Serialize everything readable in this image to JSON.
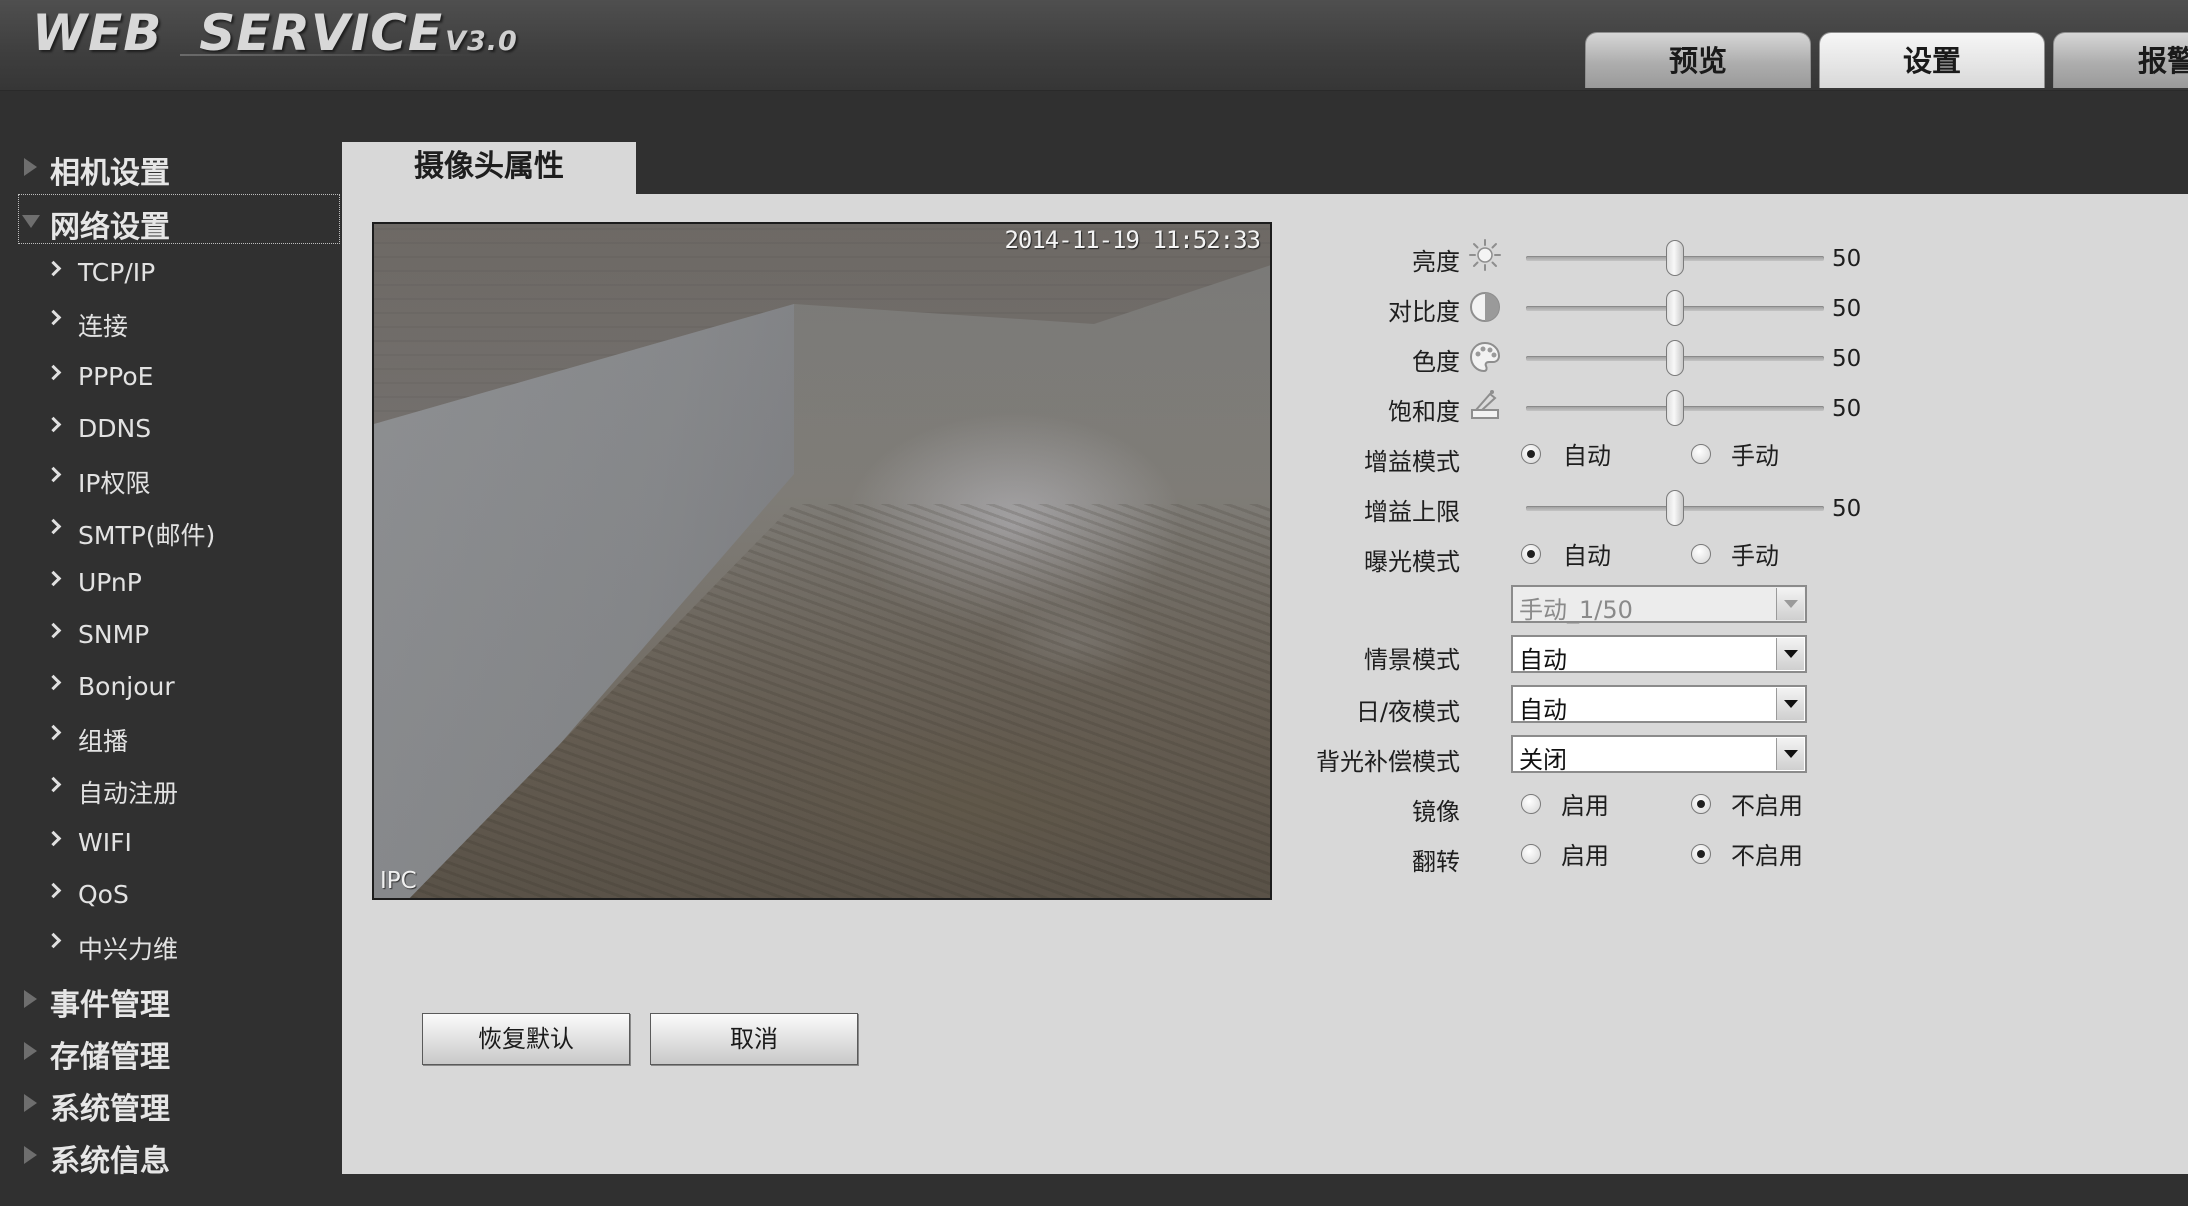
{
  "header": {
    "logo_text": "WEB  SERVICE",
    "logo_version": "V3.0",
    "tabs": [
      {
        "label": "预览",
        "active": false
      },
      {
        "label": "设置",
        "active": true
      },
      {
        "label": "报警",
        "active": false
      }
    ]
  },
  "sidebar": {
    "groups": [
      {
        "label": "相机设置",
        "expanded": false
      },
      {
        "label": "网络设置",
        "expanded": true
      },
      {
        "label": "事件管理",
        "expanded": false
      },
      {
        "label": "存储管理",
        "expanded": false
      },
      {
        "label": "系统管理",
        "expanded": false
      },
      {
        "label": "系统信息",
        "expanded": false
      }
    ],
    "network_items": [
      "TCP/IP",
      "连接",
      "PPPoE",
      "DDNS",
      "IP权限",
      "SMTP(邮件)",
      "UPnP",
      "SNMP",
      "Bonjour",
      "组播",
      "自动注册",
      "WIFI",
      "QoS",
      "中兴力维"
    ]
  },
  "content": {
    "tab_label": "摄像头属性",
    "video": {
      "timestamp": "2014-11-19 11:52:33",
      "camera_label": "IPC"
    },
    "settings": {
      "brightness": {
        "label": "亮度",
        "value": 50,
        "icon": "sun-icon"
      },
      "contrast": {
        "label": "对比度",
        "value": 50,
        "icon": "contrast-icon"
      },
      "hue": {
        "label": "色度",
        "value": 50,
        "icon": "palette-icon"
      },
      "saturation": {
        "label": "饱和度",
        "value": 50,
        "icon": "saturation-icon"
      },
      "gain_mode": {
        "label": "增益模式",
        "options": [
          "自动",
          "手动"
        ],
        "selected": "自动"
      },
      "gain_limit": {
        "label": "增益上限",
        "value": 50
      },
      "exposure_mode": {
        "label": "曝光模式",
        "options": [
          "自动",
          "手动"
        ],
        "selected": "自动"
      },
      "shutter": {
        "value": "手动_1/50",
        "disabled": true
      },
      "scene_mode": {
        "label": "情景模式",
        "value": "自动"
      },
      "day_night": {
        "label": "日/夜模式",
        "value": "自动"
      },
      "backlight": {
        "label": "背光补偿模式",
        "value": "关闭"
      },
      "mirror": {
        "label": "镜像",
        "options": [
          "启用",
          "不启用"
        ],
        "selected": "不启用"
      },
      "flip": {
        "label": "翻转",
        "options": [
          "启用",
          "不启用"
        ],
        "selected": "不启用"
      }
    },
    "buttons": {
      "restore_default": "恢复默认",
      "cancel": "取消"
    }
  },
  "colors": {
    "frame_bg": "#303030",
    "content_bg": "#d8d8d8",
    "sidebar_text": "#e6e6e6"
  }
}
